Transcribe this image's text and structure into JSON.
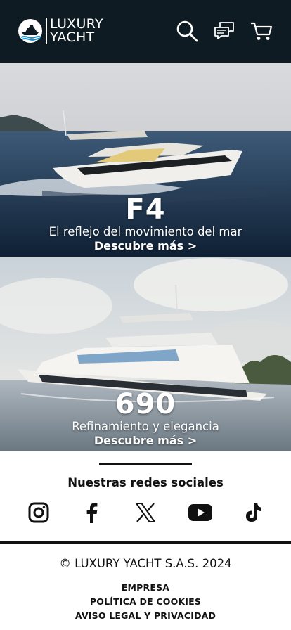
{
  "header": {
    "brand_line1": "LUXURY",
    "brand_line2": "YACHT",
    "icons": [
      "search-icon",
      "chat-icon",
      "cart-icon"
    ],
    "background": "#0e1b22"
  },
  "heroes": [
    {
      "title": "F4",
      "subtitle": "El reflejo del movimiento del mar",
      "link": "Descubre más >"
    },
    {
      "title": "690",
      "subtitle": "Refinamiento y elegancia",
      "link": "Descubre más >"
    }
  ],
  "social": {
    "title": "Nuestras redes sociales",
    "networks": [
      "instagram-icon",
      "facebook-icon",
      "x-icon",
      "youtube-icon",
      "tiktok-icon"
    ]
  },
  "footer": {
    "copyright": "© LUXURY YACHT S.A.S. 2024",
    "links": [
      "EMPRESA",
      "POLÍTICA DE COOKIES",
      "AVISO LEGAL Y PRIVACIDAD"
    ]
  }
}
